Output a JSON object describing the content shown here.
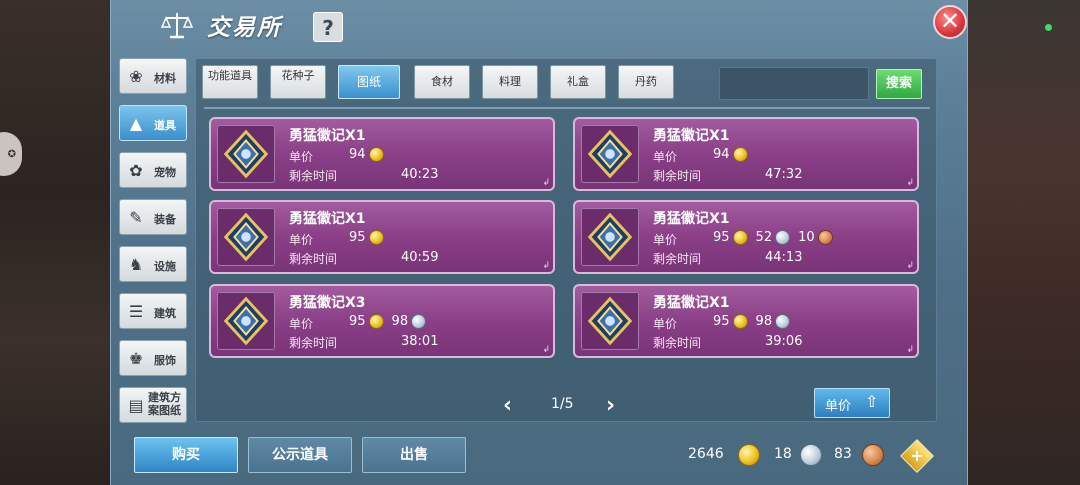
{
  "window": {
    "title": "交易所",
    "help_label": "?",
    "close_label": "✕"
  },
  "categories": [
    {
      "label": "材料",
      "icon": "materials-icon",
      "glyph": "❀",
      "active": false
    },
    {
      "label": "道具",
      "icon": "items-icon",
      "glyph": "▲",
      "active": true
    },
    {
      "label": "宠物",
      "icon": "paw-icon",
      "glyph": "✿",
      "active": false
    },
    {
      "label": "装备",
      "icon": "equipment-icon",
      "glyph": "✎",
      "active": false
    },
    {
      "label": "设施",
      "icon": "facility-icon",
      "glyph": "♞",
      "active": false
    },
    {
      "label": "建筑",
      "icon": "building-icon",
      "glyph": "☰",
      "active": false
    },
    {
      "label": "服饰",
      "icon": "clothing-icon",
      "glyph": "♚",
      "active": false
    },
    {
      "label": "建筑方案图纸",
      "icon": "blueprint-icon",
      "glyph": "▤",
      "active": false
    }
  ],
  "tabs": [
    {
      "label": "功能道具",
      "active": false
    },
    {
      "label": "花种子",
      "active": false
    },
    {
      "label": "图纸",
      "active": true
    },
    {
      "label": "食材",
      "active": false
    },
    {
      "label": "料理",
      "active": false
    },
    {
      "label": "礼盒",
      "active": false
    },
    {
      "label": "丹药",
      "active": false
    }
  ],
  "search": {
    "placeholder": "",
    "button_label": "搜索"
  },
  "listing_labels": {
    "price": "单价",
    "time": "剩余时间"
  },
  "listings": [
    {
      "name": "勇猛徽记X1",
      "gold": "94",
      "silver": "",
      "copper": "",
      "time": "40:23"
    },
    {
      "name": "勇猛徽记X1",
      "gold": "94",
      "silver": "",
      "copper": "",
      "time": "47:32"
    },
    {
      "name": "勇猛徽记X1",
      "gold": "95",
      "silver": "",
      "copper": "",
      "time": "40:59"
    },
    {
      "name": "勇猛徽记X1",
      "gold": "95",
      "silver": "52",
      "copper": "10",
      "time": "44:13"
    },
    {
      "name": "勇猛徽记X3",
      "gold": "95",
      "silver": "98",
      "copper": "",
      "time": "38:01"
    },
    {
      "name": "勇猛徽记X1",
      "gold": "95",
      "silver": "98",
      "copper": "",
      "time": "39:06"
    }
  ],
  "pagination": {
    "text": "1/5",
    "prev": "‹",
    "next": "›"
  },
  "sort": {
    "label": "单价",
    "arrow": "⇧"
  },
  "bottom": {
    "buy_label": "购买",
    "showcase_label": "公示道具",
    "sell_label": "出售"
  },
  "wallet": {
    "gold": "2646",
    "silver": "18",
    "copper": "83",
    "add_label": "+"
  },
  "colors": {
    "accent": "#3b90cd",
    "card": "#8a3f86",
    "search": "#2ea845",
    "close": "#d8353e"
  }
}
